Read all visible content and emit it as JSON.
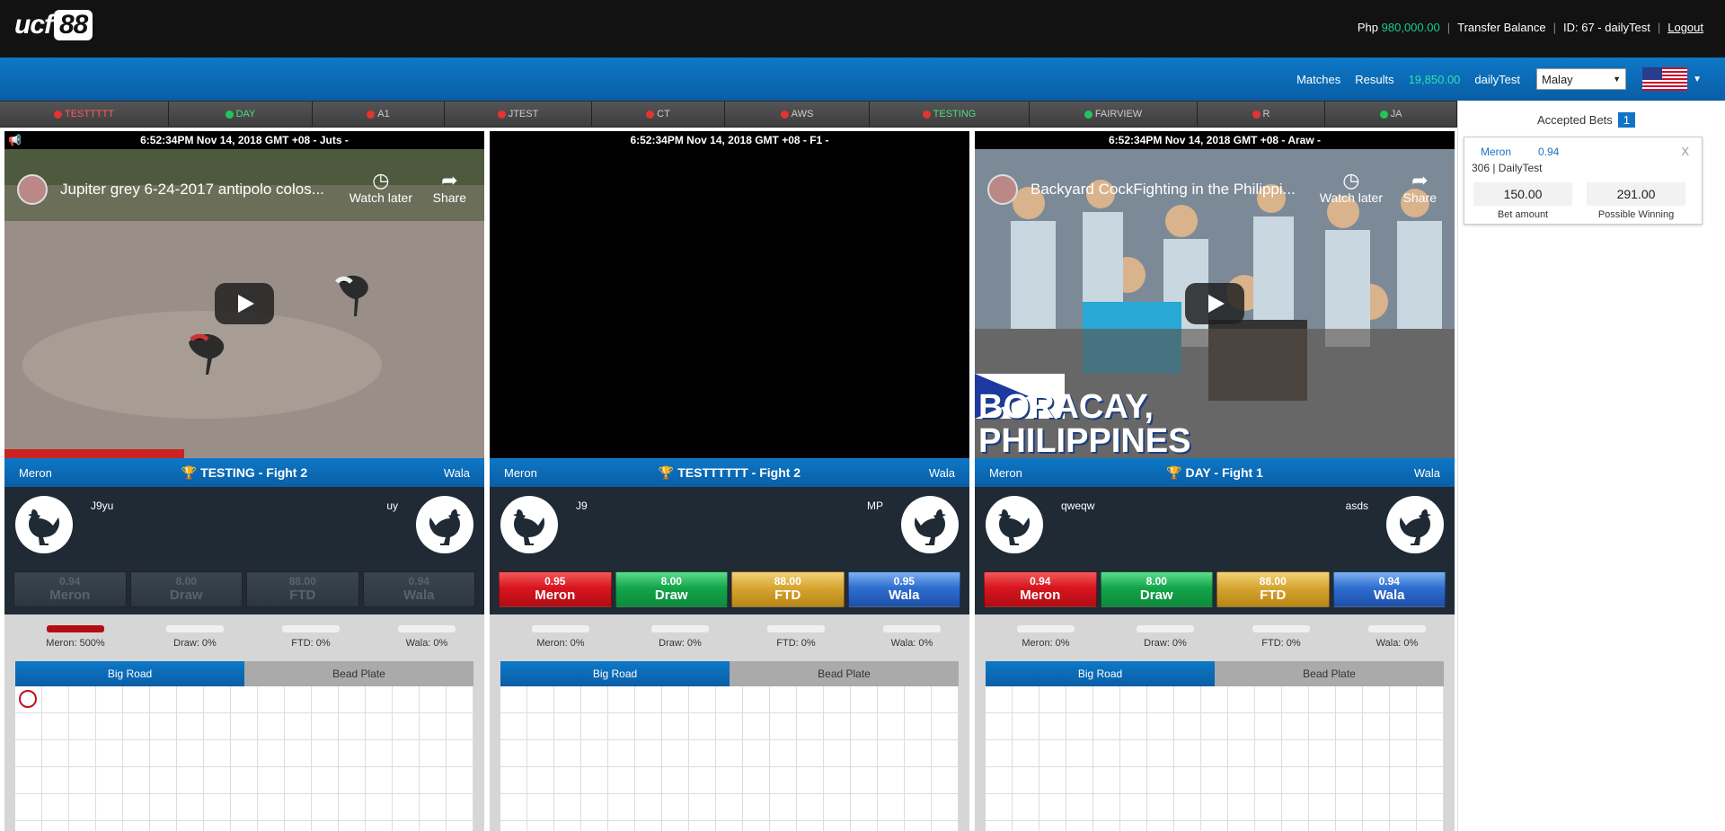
{
  "app": {
    "logo_text": "ucf",
    "logo_num": "88"
  },
  "topbar": {
    "currency": "Php",
    "balance": "980,000.00",
    "transfer": "Transfer Balance",
    "id_text": "ID: 67 - dailyTest",
    "logout": "Logout"
  },
  "nav": {
    "matches": "Matches",
    "results": "Results",
    "credit": "19,850.00",
    "user": "dailyTest",
    "language": "Malay",
    "flag": "us-flag-icon"
  },
  "tabs": [
    {
      "label": "TESTTTTT",
      "status": "red"
    },
    {
      "label": "DAY",
      "status": "green"
    },
    {
      "label": "A1",
      "status": "red"
    },
    {
      "label": "JTEST",
      "status": "red"
    },
    {
      "label": "CT",
      "status": "red"
    },
    {
      "label": "AWS",
      "status": "red"
    },
    {
      "label": "TESTING",
      "status": "red"
    },
    {
      "label": "FAIRVIEW",
      "status": "green"
    },
    {
      "label": "R",
      "status": "red"
    },
    {
      "label": "JA",
      "status": "green"
    }
  ],
  "panels": [
    {
      "timestamp": "6:52:34PM Nov 14, 2018 GMT +08 - Juts -",
      "video_title": "Jupiter grey 6-24-2017 antipolo colos...",
      "watch_later": "Watch later",
      "share": "Share",
      "left_label": "Meron",
      "right_label": "Wala",
      "fight": "TESTING - Fight 2",
      "meron_name": "J9yu",
      "wala_name": "uy",
      "odds": {
        "meron": "0.94",
        "draw": "8.00",
        "ftd": "88.00",
        "wala": "0.94"
      },
      "odds_names": {
        "meron": "Meron",
        "draw": "Draw",
        "ftd": "FTD",
        "wala": "Wala"
      },
      "stats": {
        "meron": "Meron: 500%",
        "draw": "Draw: 0%",
        "ftd": "FTD: 0%",
        "wala": "Wala: 0%"
      },
      "road_tabs": {
        "big": "Big Road",
        "bead": "Bead Plate"
      }
    },
    {
      "timestamp": "6:52:34PM Nov 14, 2018 GMT +08 - F1 -",
      "left_label": "Meron",
      "right_label": "Wala",
      "fight": "TESTTTTTT - Fight 2",
      "meron_name": "J9",
      "wala_name": "MP",
      "odds": {
        "meron": "0.95",
        "draw": "8.00",
        "ftd": "88.00",
        "wala": "0.95"
      },
      "odds_names": {
        "meron": "Meron",
        "draw": "Draw",
        "ftd": "FTD",
        "wala": "Wala"
      },
      "stats": {
        "meron": "Meron: 0%",
        "draw": "Draw: 0%",
        "ftd": "FTD: 0%",
        "wala": "Wala: 0%"
      },
      "road_tabs": {
        "big": "Big Road",
        "bead": "Bead Plate"
      }
    },
    {
      "timestamp": "6:52:34PM Nov 14, 2018 GMT +08 - Araw -",
      "video_title": "Backyard CockFighting in the Philippi...",
      "watch_later": "Watch later",
      "share": "Share",
      "left_label": "Meron",
      "right_label": "Wala",
      "fight": "DAY - Fight 1",
      "meron_name": "qweqw",
      "wala_name": "asds",
      "odds": {
        "meron": "0.94",
        "draw": "8.00",
        "ftd": "88.00",
        "wala": "0.94"
      },
      "odds_names": {
        "meron": "Meron",
        "draw": "Draw",
        "ftd": "FTD",
        "wala": "Wala"
      },
      "stats": {
        "meron": "Meron: 0%",
        "draw": "Draw: 0%",
        "ftd": "FTD: 0%",
        "wala": "Wala: 0%"
      },
      "road_tabs": {
        "big": "Big Road",
        "bead": "Bead Plate"
      },
      "overlay_text_1": "BORACAY,",
      "overlay_text_2": "PHILIPPINES"
    }
  ],
  "sidebar": {
    "title": "Accepted Bets",
    "count": "1",
    "bet": {
      "side": "Meron",
      "odds": "0.94",
      "close": "X",
      "info": "306 | DailyTest",
      "amount": "150.00",
      "winning": "291.00",
      "amount_label": "Bet amount",
      "winning_label": "Possible Winning"
    }
  }
}
